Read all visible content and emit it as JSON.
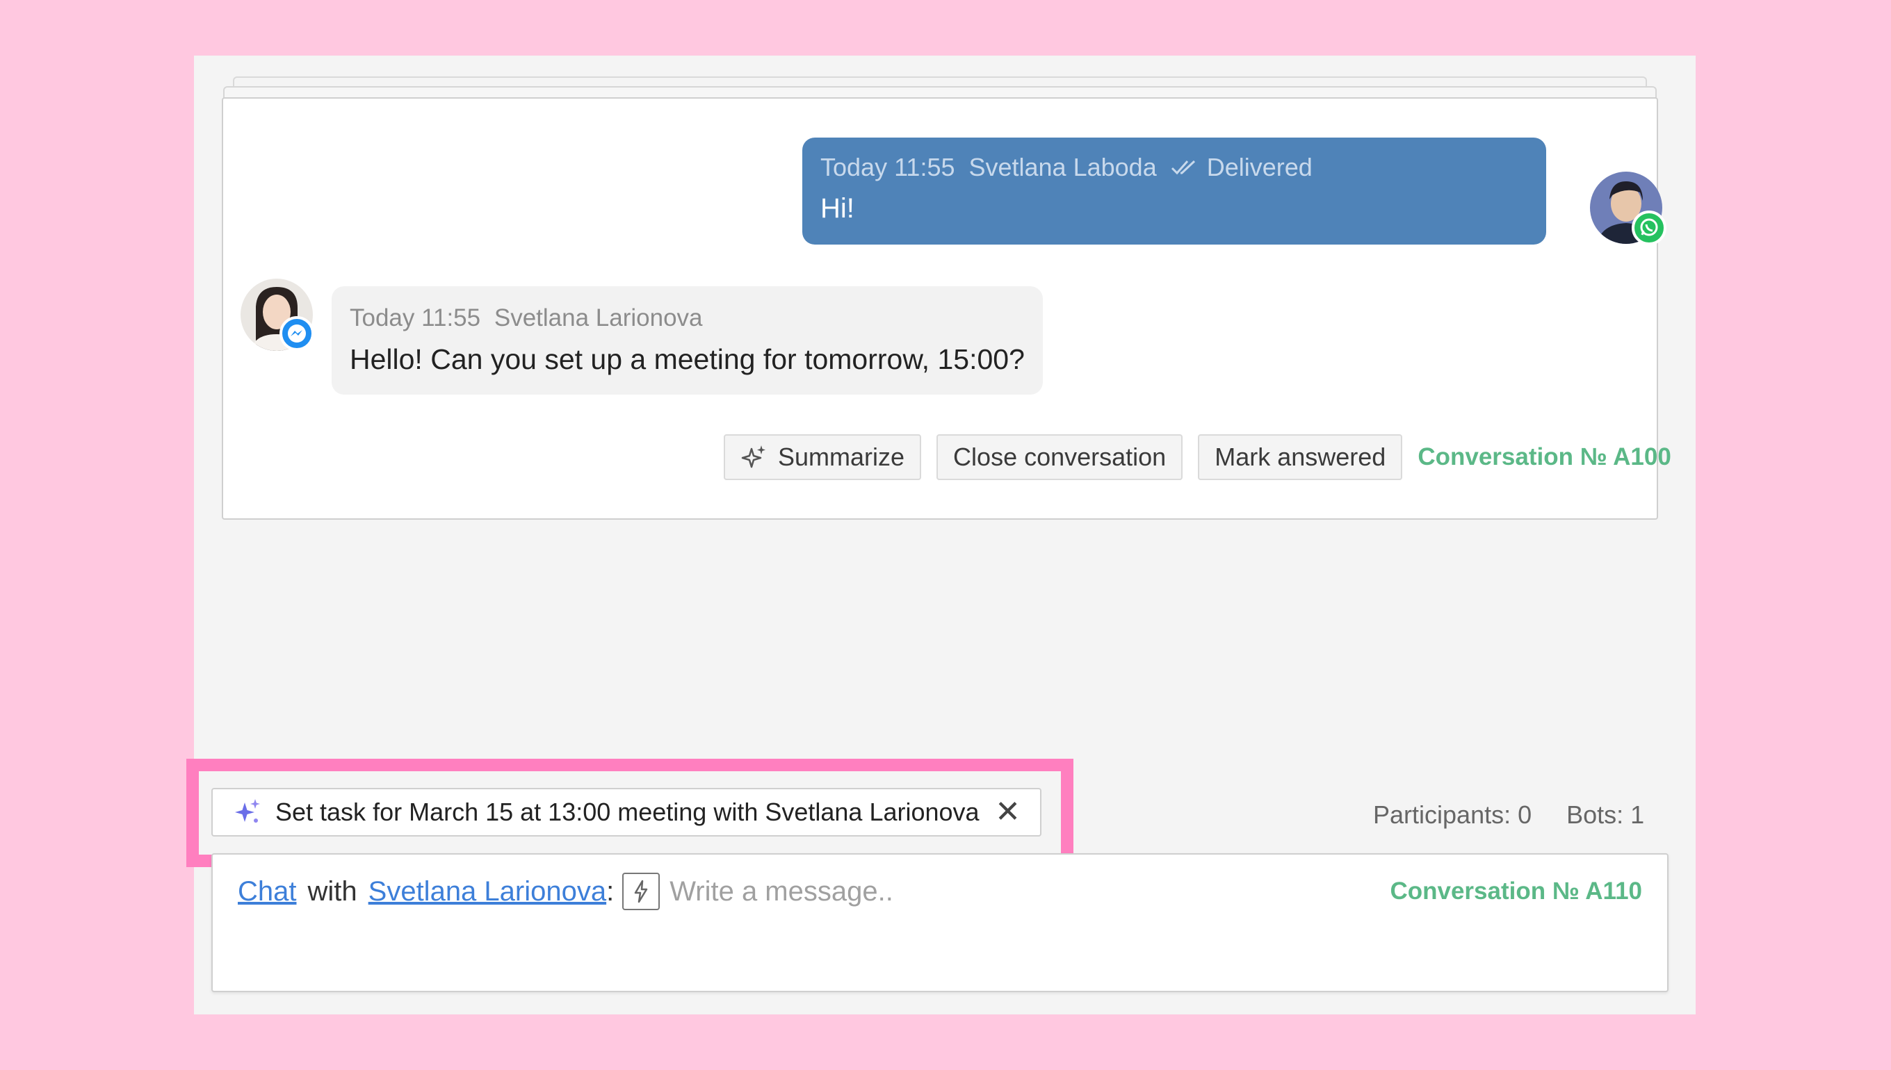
{
  "messages": {
    "outgoing": {
      "time": "Today 11:55",
      "author": "Svetlana Laboda",
      "status": "Delivered",
      "text": "Hi!",
      "channel_icon": "whatsapp-icon"
    },
    "incoming": {
      "time": "Today 11:55",
      "author": "Svetlana Larionova",
      "text": "Hello! Can you set up a meeting for tomorrow,  15:00?",
      "channel_icon": "messenger-icon"
    }
  },
  "actions": {
    "summarize": "Summarize",
    "close_conversation": "Close conversation",
    "mark_answered": "Mark answered",
    "conversation_label": "Conversation № A100"
  },
  "stats": {
    "participants": "Participants: 0",
    "bots": "Bots: 1"
  },
  "suggestion": {
    "text": "Set task for March 15 at 13:00 meeting with Svetlana Larionova",
    "close_glyph": "✕"
  },
  "composer": {
    "chat_link": "Chat",
    "with_text": "with",
    "contact_link": "Svetlana Larionova",
    "colon": ":",
    "placeholder": "Write a message..",
    "conversation_label": "Conversation № A110"
  },
  "colors": {
    "background": "#ffc8e0",
    "highlight": "#ff7fbf",
    "outgoing_bubble": "#4f83b8",
    "accent_green": "#5bb887",
    "link": "#3d7fd9"
  }
}
